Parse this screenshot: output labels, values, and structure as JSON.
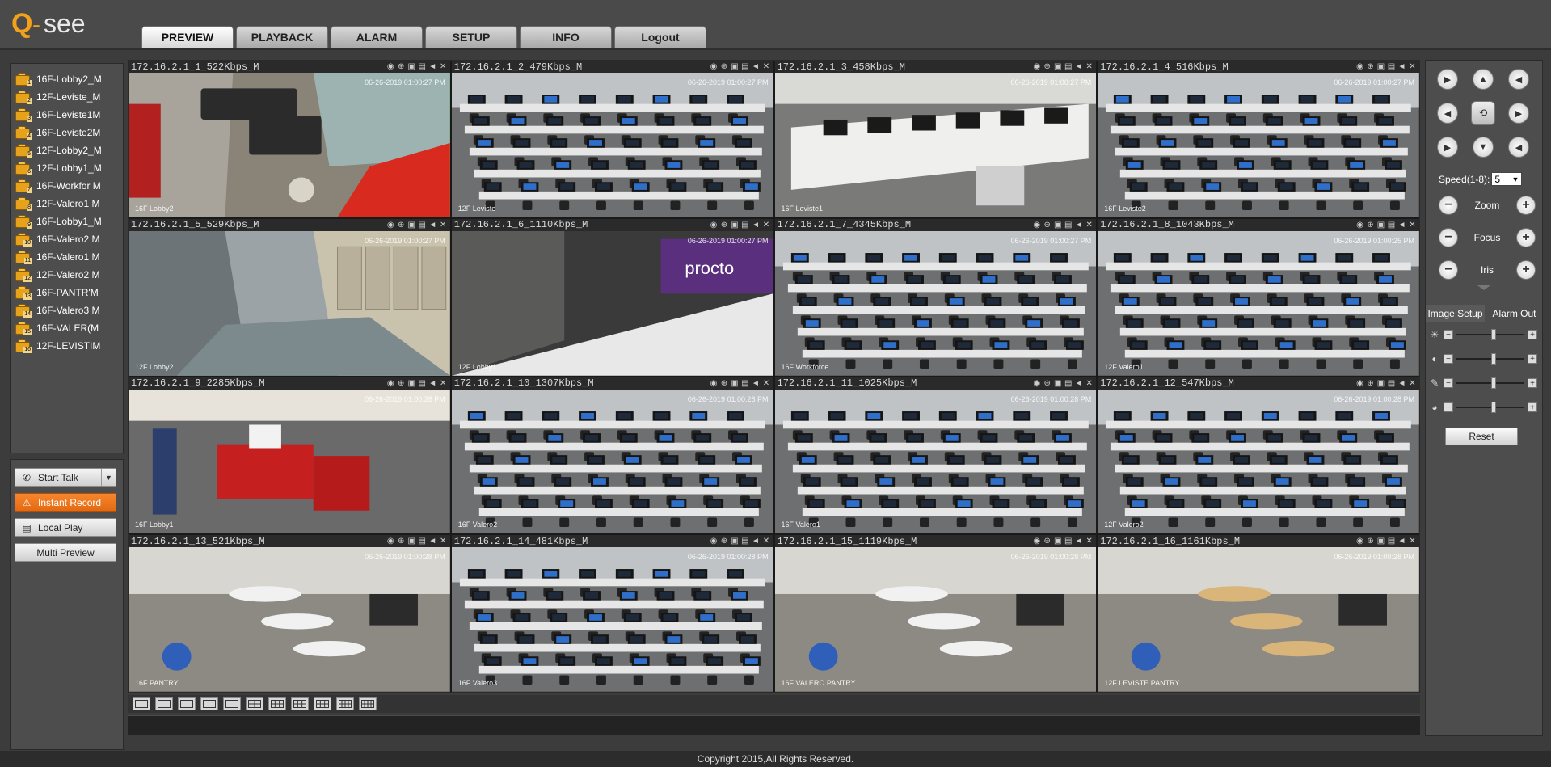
{
  "brand": {
    "logo_text": "Q-see"
  },
  "nav": {
    "tabs": [
      {
        "label": "PREVIEW",
        "active": true
      },
      {
        "label": "PLAYBACK"
      },
      {
        "label": "ALARM"
      },
      {
        "label": "SETUP"
      },
      {
        "label": "INFO"
      },
      {
        "label": "Logout"
      }
    ]
  },
  "channels": [
    {
      "num": "1",
      "label": "16F-Lobby2_M"
    },
    {
      "num": "2",
      "label": "12F-Leviste_M"
    },
    {
      "num": "3",
      "label": "16F-Leviste1M"
    },
    {
      "num": "4",
      "label": "16F-Leviste2M"
    },
    {
      "num": "5",
      "label": "12F-Lobby2_M"
    },
    {
      "num": "6",
      "label": "12F-Lobby1_M"
    },
    {
      "num": "7",
      "label": "16F-Workfor M"
    },
    {
      "num": "8",
      "label": "12F-Valero1 M"
    },
    {
      "num": "9",
      "label": "16F-Lobby1_M"
    },
    {
      "num": "10",
      "label": "16F-Valero2 M"
    },
    {
      "num": "11",
      "label": "16F-Valero1 M"
    },
    {
      "num": "12",
      "label": "12F-Valero2 M"
    },
    {
      "num": "13",
      "label": "16F-PANTR'M"
    },
    {
      "num": "14",
      "label": "16F-Valero3 M"
    },
    {
      "num": "15",
      "label": "16F-VALER(M"
    },
    {
      "num": "16",
      "label": "12F-LEVISTIM"
    }
  ],
  "left_controls": {
    "start_talk": "Start Talk",
    "instant_record": "Instant Record",
    "local_play": "Local Play",
    "multi_preview": "Multi Preview"
  },
  "tiles": [
    {
      "title": "172.16.2.1_1_522Kbps_M",
      "ts": "06-26-2019 01:00:27 PM",
      "name": "16F Lobby2",
      "scene": "lobby"
    },
    {
      "title": "172.16.2.1_2_479Kbps_M",
      "ts": "06-26-2019 01:00:27 PM",
      "name": "12F Leviste",
      "scene": "office"
    },
    {
      "title": "172.16.2.1_3_458Kbps_M",
      "ts": "06-26-2019 01:00:27 PM",
      "name": "16F Leviste1",
      "scene": "desks"
    },
    {
      "title": "172.16.2.1_4_516Kbps_M",
      "ts": "06-26-2019 01:00:27 PM",
      "name": "16F Leviste2",
      "scene": "office"
    },
    {
      "title": "172.16.2.1_5_529Kbps_M",
      "ts": "06-26-2019 01:00:27 PM",
      "name": "12F Lobby2",
      "scene": "corridor"
    },
    {
      "title": "172.16.2.1_6_1110Kbps_M",
      "ts": "06-26-2019 01:00:27 PM",
      "name": "12F Lobby1",
      "scene": "wall"
    },
    {
      "title": "172.16.2.1_7_4345Kbps_M",
      "ts": "06-26-2019 01:00:27 PM",
      "name": "16F Workforce",
      "scene": "office"
    },
    {
      "title": "172.16.2.1_8_1043Kbps_M",
      "ts": "06-26-2019 01:00:25 PM",
      "name": "12F Valero1",
      "scene": "office"
    },
    {
      "title": "172.16.2.1_9_2285Kbps_M",
      "ts": "06-26-2019 01:00:28 PM",
      "name": "16F Lobby1",
      "scene": "reception"
    },
    {
      "title": "172.16.2.1_10_1307Kbps_M",
      "ts": "06-26-2019 01:00:28 PM",
      "name": "16F Valero2",
      "scene": "office"
    },
    {
      "title": "172.16.2.1_11_1025Kbps_M",
      "ts": "06-26-2019 01:00:28 PM",
      "name": "16F Valero1",
      "scene": "office"
    },
    {
      "title": "172.16.2.1_12_547Kbps_M",
      "ts": "06-26-2019 01:00:28 PM",
      "name": "12F Valero2",
      "scene": "office"
    },
    {
      "title": "172.16.2.1_13_521Kbps_M",
      "ts": "06-26-2019 01:00:28 PM",
      "name": "16F PANTRY",
      "scene": "pantry"
    },
    {
      "title": "172.16.2.1_14_481Kbps_M",
      "ts": "06-26-2019 01:00:28 PM",
      "name": "16F Valero3",
      "scene": "office"
    },
    {
      "title": "172.16.2.1_15_1119Kbps_M",
      "ts": "06-26-2019 01:00:28 PM",
      "name": "16F VALERO PANTRY",
      "scene": "pantry"
    },
    {
      "title": "172.16.2.1_16_1161Kbps_M",
      "ts": "06-26-2019 01:00:28 PM",
      "name": "12F LEVISTE PANTRY",
      "scene": "pantry"
    }
  ],
  "ptz": {
    "speed_label": "Speed(1-8):",
    "speed_value": "5",
    "zoom": "Zoom",
    "focus": "Focus",
    "iris": "Iris"
  },
  "image_setup": {
    "tab1": "Image Setup",
    "tab2": "Alarm Out",
    "sliders": [
      {
        "icon": "brightness-icon",
        "glyph": "☀",
        "level": 0.55
      },
      {
        "icon": "contrast-icon",
        "glyph": "◐",
        "level": 0.55
      },
      {
        "icon": "saturation-icon",
        "glyph": "✎",
        "level": 0.55
      },
      {
        "icon": "hue-icon",
        "glyph": "◕",
        "level": 0.55
      }
    ],
    "reset": "Reset"
  },
  "footer": {
    "copyright": "Copyright 2015,All Rights Reserved."
  }
}
